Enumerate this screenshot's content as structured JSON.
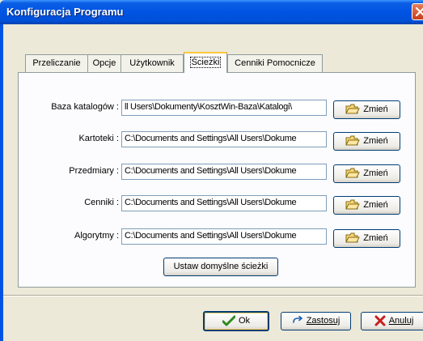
{
  "window": {
    "title": "Konfiguracja Programu"
  },
  "tabs": [
    {
      "label": "Przeliczanie",
      "active": false
    },
    {
      "label": "Opcje",
      "active": false
    },
    {
      "label": "Użytkownik",
      "active": false
    },
    {
      "label": "Ścieżki",
      "active": true
    },
    {
      "label": "Cenniki Pomocnicze",
      "active": false
    }
  ],
  "paths": [
    {
      "label": "Baza katalogów :",
      "value": "ll Users\\Dokumenty\\KosztWin-Baza\\Katalogi\\",
      "button": "Zmień"
    },
    {
      "label": "Kartoteki :",
      "value": "C:\\Documents and Settings\\All Users\\Dokume",
      "button": "Zmień"
    },
    {
      "label": "Przedmiary :",
      "value": "C:\\Documents and Settings\\All Users\\Dokume",
      "button": "Zmień"
    },
    {
      "label": "Cenniki :",
      "value": "C:\\Documents and Settings\\All Users\\Dokume",
      "button": "Zmień"
    },
    {
      "label": "Algorytmy :",
      "value": "C:\\Documents and Settings\\All Users\\Dokume",
      "button": "Zmień"
    }
  ],
  "default_paths_button": "Ustaw domyślne ścieżki",
  "footer": {
    "ok": "Ok",
    "apply": "Zastosuj",
    "cancel": "Anuluj"
  },
  "colors": {
    "titlebar": "#0054E3",
    "dialog_bg": "#ECE9D8",
    "active_tab_accent": "#FFC83C",
    "ok_icon": "#2E8B1E",
    "cancel_icon": "#C81E1E"
  }
}
